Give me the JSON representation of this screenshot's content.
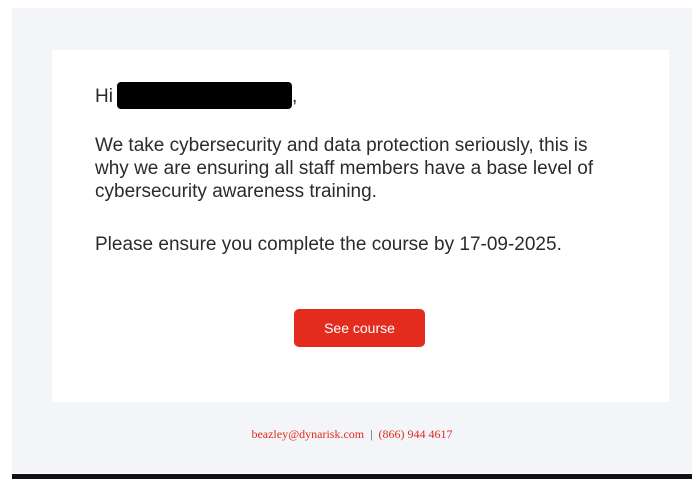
{
  "email": {
    "greeting_prefix": "Hi",
    "greeting_suffix": ",",
    "paragraph1": "We take cybersecurity and data protection seriously, this is why we are ensuring all staff members have a base level of cybersecurity awareness training.",
    "paragraph2": "Please ensure you complete the course by 17-09-2025.",
    "cta_label": "See course"
  },
  "footer": {
    "email": "beazley@dynarisk.com",
    "separator": "|",
    "phone": "(866) 944 4617"
  },
  "colors": {
    "accent": "#e32b1e",
    "background": "#f3f5f8",
    "card": "#ffffff",
    "text": "#2b2b2b"
  }
}
